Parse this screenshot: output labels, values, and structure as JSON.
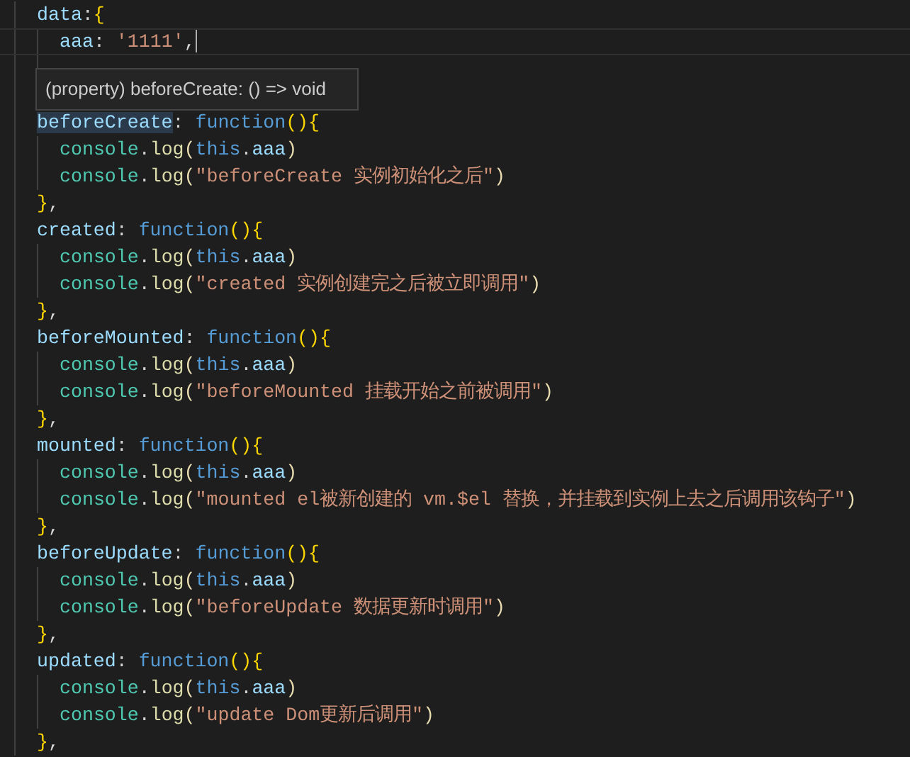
{
  "editor": {
    "code": [
      {
        "current": false,
        "tokens": [
          {
            "kind": "key",
            "t": "data"
          },
          {
            "kind": "punct",
            "t": ":"
          },
          {
            "kind": "br",
            "t": "{"
          }
        ],
        "children": [
          {
            "current": true,
            "tokens": [
              {
                "kind": "key",
                "t": "aaa"
              },
              {
                "kind": "punct",
                "t": ": "
              },
              {
                "kind": "str",
                "t": "'1111'"
              },
              {
                "kind": "punct",
                "t": ","
              }
            ]
          },
          {
            "current": false
          }
        ]
      },
      {
        "current": false
      },
      {
        "current": false,
        "tokens": [
          {
            "kind": "key",
            "t": "beforeCreate",
            "highlighted": true
          },
          {
            "kind": "punct",
            "t": ": "
          },
          {
            "kind": "kw",
            "t": "function"
          },
          {
            "kind": "br",
            "t": "(){"
          }
        ],
        "children": [
          {
            "current": false,
            "tokens": [
              {
                "kind": "cls",
                "t": "console"
              },
              {
                "kind": "punct",
                "t": "."
              },
              {
                "kind": "fn",
                "t": "log"
              },
              {
                "kind": "br2",
                "t": "("
              },
              {
                "kind": "kw",
                "t": "this"
              },
              {
                "kind": "punct",
                "t": "."
              },
              {
                "kind": "key",
                "t": "aaa"
              },
              {
                "kind": "br2",
                "t": ")"
              }
            ]
          },
          {
            "current": false,
            "tokens": [
              {
                "kind": "cls",
                "t": "console"
              },
              {
                "kind": "punct",
                "t": "."
              },
              {
                "kind": "fn",
                "t": "log"
              },
              {
                "kind": "br2",
                "t": "("
              },
              {
                "kind": "str",
                "t": "\"beforeCreate 实例初始化之后\""
              },
              {
                "kind": "br2",
                "t": ")"
              }
            ]
          }
        ]
      },
      {
        "current": false,
        "tokens": [
          {
            "kind": "br",
            "t": "}"
          },
          {
            "kind": "punct",
            "t": ","
          }
        ]
      },
      {
        "current": false,
        "tokens": [
          {
            "kind": "key",
            "t": "created"
          },
          {
            "kind": "punct",
            "t": ": "
          },
          {
            "kind": "kw",
            "t": "function"
          },
          {
            "kind": "br",
            "t": "(){"
          }
        ],
        "children": [
          {
            "current": false,
            "tokens": [
              {
                "kind": "cls",
                "t": "console"
              },
              {
                "kind": "punct",
                "t": "."
              },
              {
                "kind": "fn",
                "t": "log"
              },
              {
                "kind": "br2",
                "t": "("
              },
              {
                "kind": "kw",
                "t": "this"
              },
              {
                "kind": "punct",
                "t": "."
              },
              {
                "kind": "key",
                "t": "aaa"
              },
              {
                "kind": "br2",
                "t": ")"
              }
            ]
          },
          {
            "current": false,
            "tokens": [
              {
                "kind": "cls",
                "t": "console"
              },
              {
                "kind": "punct",
                "t": "."
              },
              {
                "kind": "fn",
                "t": "log"
              },
              {
                "kind": "br2",
                "t": "("
              },
              {
                "kind": "str",
                "t": "\"created 实例创建完之后被立即调用\""
              },
              {
                "kind": "br2",
                "t": ")"
              }
            ]
          }
        ]
      },
      {
        "current": false,
        "tokens": [
          {
            "kind": "br",
            "t": "}"
          },
          {
            "kind": "punct",
            "t": ","
          }
        ]
      },
      {
        "current": false,
        "tokens": [
          {
            "kind": "key",
            "t": "beforeMounted"
          },
          {
            "kind": "punct",
            "t": ": "
          },
          {
            "kind": "kw",
            "t": "function"
          },
          {
            "kind": "br",
            "t": "(){"
          }
        ],
        "children": [
          {
            "current": false,
            "tokens": [
              {
                "kind": "cls",
                "t": "console"
              },
              {
                "kind": "punct",
                "t": "."
              },
              {
                "kind": "fn",
                "t": "log"
              },
              {
                "kind": "br2",
                "t": "("
              },
              {
                "kind": "kw",
                "t": "this"
              },
              {
                "kind": "punct",
                "t": "."
              },
              {
                "kind": "key",
                "t": "aaa"
              },
              {
                "kind": "br2",
                "t": ")"
              }
            ]
          },
          {
            "current": false,
            "tokens": [
              {
                "kind": "cls",
                "t": "console"
              },
              {
                "kind": "punct",
                "t": "."
              },
              {
                "kind": "fn",
                "t": "log"
              },
              {
                "kind": "br2",
                "t": "("
              },
              {
                "kind": "str",
                "t": "\"beforeMounted 挂载开始之前被调用\""
              },
              {
                "kind": "br2",
                "t": ")"
              }
            ]
          }
        ]
      },
      {
        "current": false,
        "tokens": [
          {
            "kind": "br",
            "t": "}"
          },
          {
            "kind": "punct",
            "t": ","
          }
        ]
      },
      {
        "current": false,
        "tokens": [
          {
            "kind": "key",
            "t": "mounted"
          },
          {
            "kind": "punct",
            "t": ": "
          },
          {
            "kind": "kw",
            "t": "function"
          },
          {
            "kind": "br",
            "t": "(){"
          }
        ],
        "children": [
          {
            "current": false,
            "tokens": [
              {
                "kind": "cls",
                "t": "console"
              },
              {
                "kind": "punct",
                "t": "."
              },
              {
                "kind": "fn",
                "t": "log"
              },
              {
                "kind": "br2",
                "t": "("
              },
              {
                "kind": "kw",
                "t": "this"
              },
              {
                "kind": "punct",
                "t": "."
              },
              {
                "kind": "key",
                "t": "aaa"
              },
              {
                "kind": "br2",
                "t": ")"
              }
            ]
          },
          {
            "current": false,
            "tokens": [
              {
                "kind": "cls",
                "t": "console"
              },
              {
                "kind": "punct",
                "t": "."
              },
              {
                "kind": "fn",
                "t": "log"
              },
              {
                "kind": "br2",
                "t": "("
              },
              {
                "kind": "str",
                "t": "\"mounted el被新创建的 vm.$el 替换，并挂载到实例上去之后调用该钩子\""
              },
              {
                "kind": "br2",
                "t": ")"
              }
            ]
          }
        ]
      },
      {
        "current": false,
        "tokens": [
          {
            "kind": "br",
            "t": "}"
          },
          {
            "kind": "punct",
            "t": ","
          }
        ]
      },
      {
        "current": false,
        "tokens": [
          {
            "kind": "key",
            "t": "beforeUpdate"
          },
          {
            "kind": "punct",
            "t": ": "
          },
          {
            "kind": "kw",
            "t": "function"
          },
          {
            "kind": "br",
            "t": "(){"
          }
        ],
        "children": [
          {
            "current": false,
            "tokens": [
              {
                "kind": "cls",
                "t": "console"
              },
              {
                "kind": "punct",
                "t": "."
              },
              {
                "kind": "fn",
                "t": "log"
              },
              {
                "kind": "br2",
                "t": "("
              },
              {
                "kind": "kw",
                "t": "this"
              },
              {
                "kind": "punct",
                "t": "."
              },
              {
                "kind": "key",
                "t": "aaa"
              },
              {
                "kind": "br2",
                "t": ")"
              }
            ]
          },
          {
            "current": false,
            "tokens": [
              {
                "kind": "cls",
                "t": "console"
              },
              {
                "kind": "punct",
                "t": "."
              },
              {
                "kind": "fn",
                "t": "log"
              },
              {
                "kind": "br2",
                "t": "("
              },
              {
                "kind": "str",
                "t": "\"beforeUpdate 数据更新时调用\""
              },
              {
                "kind": "br2",
                "t": ")"
              }
            ]
          }
        ]
      },
      {
        "current": false,
        "tokens": [
          {
            "kind": "br",
            "t": "}"
          },
          {
            "kind": "punct",
            "t": ","
          }
        ]
      },
      {
        "current": false,
        "tokens": [
          {
            "kind": "key",
            "t": "updated"
          },
          {
            "kind": "punct",
            "t": ": "
          },
          {
            "kind": "kw",
            "t": "function"
          },
          {
            "kind": "br",
            "t": "(){"
          }
        ],
        "children": [
          {
            "current": false,
            "tokens": [
              {
                "kind": "cls",
                "t": "console"
              },
              {
                "kind": "punct",
                "t": "."
              },
              {
                "kind": "fn",
                "t": "log"
              },
              {
                "kind": "br2",
                "t": "("
              },
              {
                "kind": "kw",
                "t": "this"
              },
              {
                "kind": "punct",
                "t": "."
              },
              {
                "kind": "key",
                "t": "aaa"
              },
              {
                "kind": "br2",
                "t": ")"
              }
            ]
          },
          {
            "current": false,
            "tokens": [
              {
                "kind": "cls",
                "t": "console"
              },
              {
                "kind": "punct",
                "t": "."
              },
              {
                "kind": "fn",
                "t": "log"
              },
              {
                "kind": "br2",
                "t": "("
              },
              {
                "kind": "str",
                "t": "\"update Dom更新后调用\""
              },
              {
                "kind": "br2",
                "t": ")"
              }
            ]
          }
        ]
      },
      {
        "current": false,
        "tokens": [
          {
            "kind": "br",
            "t": "}"
          },
          {
            "kind": "punct",
            "t": ","
          }
        ]
      }
    ],
    "tooltip": {
      "text": "(property) beforeCreate: () => void"
    }
  }
}
